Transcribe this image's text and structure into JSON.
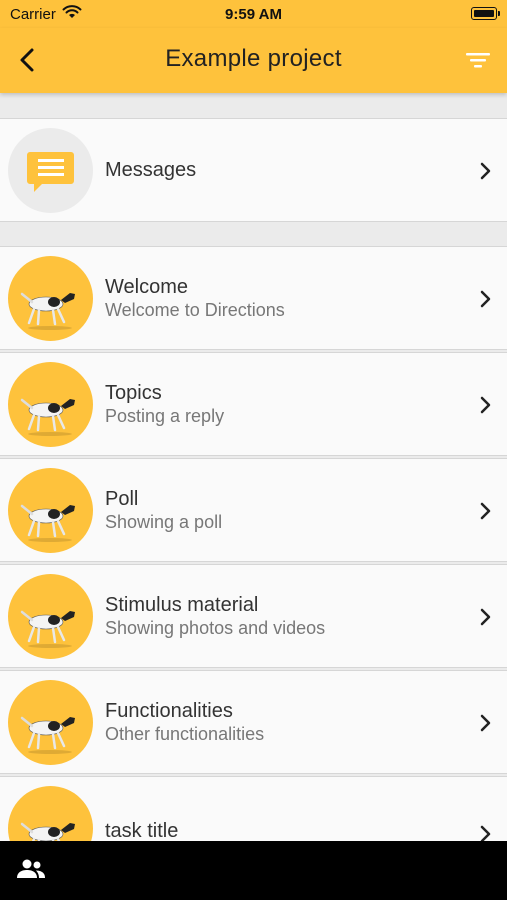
{
  "status": {
    "carrier": "Carrier",
    "time": "9:59 AM"
  },
  "header": {
    "title": "Example project"
  },
  "messages": {
    "label": "Messages"
  },
  "items": [
    {
      "title": "Welcome",
      "subtitle": "Welcome to Directions"
    },
    {
      "title": "Topics",
      "subtitle": "Posting a reply"
    },
    {
      "title": "Poll",
      "subtitle": "Showing a poll"
    },
    {
      "title": "Stimulus material",
      "subtitle": "Showing photos and videos"
    },
    {
      "title": "Functionalities",
      "subtitle": "Other functionalities"
    },
    {
      "title": "task title",
      "subtitle": ""
    }
  ],
  "colors": {
    "accent": "#fec23c",
    "background": "#ebebeb",
    "row": "#fafafa"
  }
}
